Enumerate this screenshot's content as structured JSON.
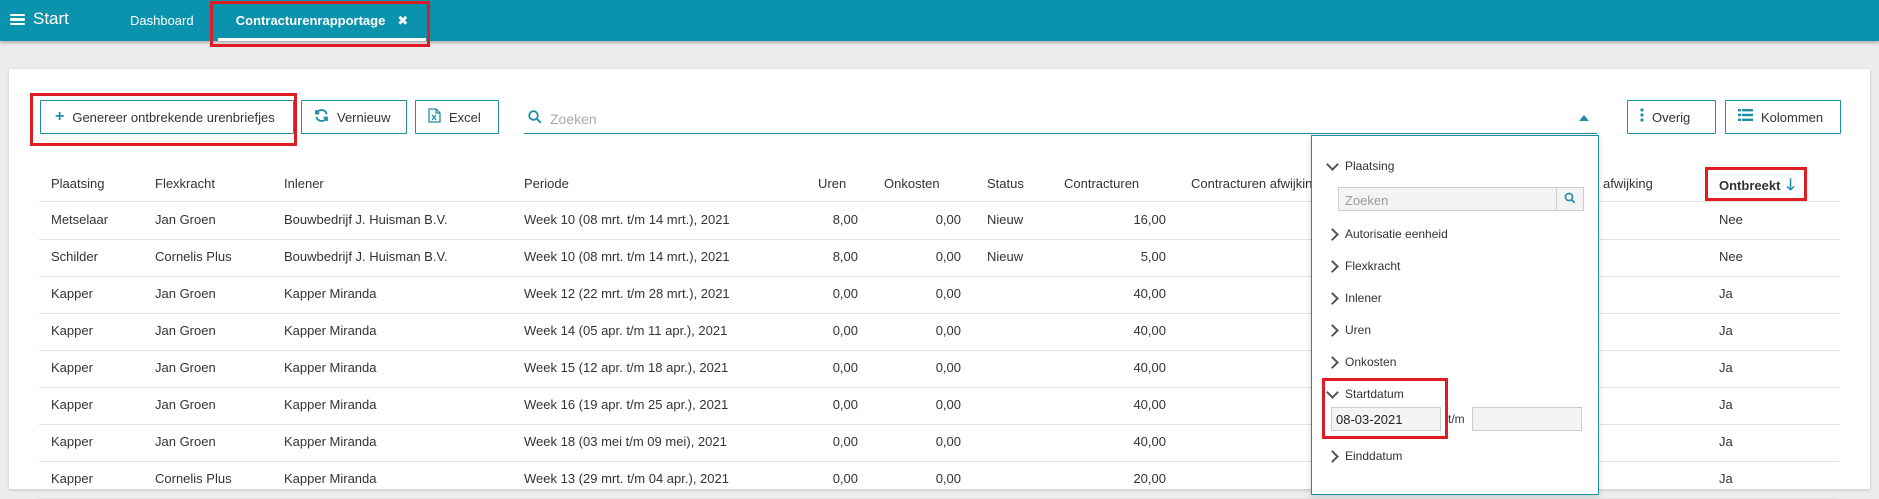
{
  "topbar": {
    "menu_label": "Start",
    "tabs": [
      {
        "label": "Dashboard"
      },
      {
        "label": "Contracturenrapportage",
        "close": "✖"
      }
    ]
  },
  "toolbar": {
    "generate_label": "Genereer ontbrekende urenbriefjes",
    "refresh_label": "Vernieuw",
    "excel_label": "Excel",
    "search_placeholder": "Zoeken",
    "other_label": "Overig",
    "columns_label": "Kolommen"
  },
  "table": {
    "headers": {
      "plaatsing": "Plaatsing",
      "flexkracht": "Flexkracht",
      "inlener": "Inlener",
      "periode": "Periode",
      "uren": "Uren",
      "onkosten": "Onkosten",
      "status": "Status",
      "contracturen": "Contracturen",
      "contracturen_afwijking": "Contracturen afwijkin",
      "afwijking": "afwijking",
      "ontbreekt": "Ontbreekt"
    },
    "rows": [
      {
        "plaatsing": "Metselaar",
        "flexkracht": "Jan Groen",
        "inlener": "Bouwbedrijf J. Huisman B.V.",
        "periode": "Week 10 (08 mrt. t/m 14 mrt.), 2021",
        "uren": "8,00",
        "onkosten": "0,00",
        "status": "Nieuw",
        "contracturen": "16,00",
        "ontbreekt": "Nee"
      },
      {
        "plaatsing": "Schilder",
        "flexkracht": "Cornelis Plus",
        "inlener": "Bouwbedrijf J. Huisman B.V.",
        "periode": "Week 10 (08 mrt. t/m 14 mrt.), 2021",
        "uren": "8,00",
        "onkosten": "0,00",
        "status": "Nieuw",
        "contracturen": "5,00",
        "ontbreekt": "Nee"
      },
      {
        "plaatsing": "Kapper",
        "flexkracht": "Jan Groen",
        "inlener": "Kapper Miranda",
        "periode": "Week 12 (22 mrt. t/m 28 mrt.), 2021",
        "uren": "0,00",
        "onkosten": "0,00",
        "status": "",
        "contracturen": "40,00",
        "ontbreekt": "Ja"
      },
      {
        "plaatsing": "Kapper",
        "flexkracht": "Jan Groen",
        "inlener": "Kapper Miranda",
        "periode": "Week 14 (05 apr. t/m 11 apr.), 2021",
        "uren": "0,00",
        "onkosten": "0,00",
        "status": "",
        "contracturen": "40,00",
        "ontbreekt": "Ja"
      },
      {
        "plaatsing": "Kapper",
        "flexkracht": "Jan Groen",
        "inlener": "Kapper Miranda",
        "periode": "Week 15 (12 apr. t/m 18 apr.), 2021",
        "uren": "0,00",
        "onkosten": "0,00",
        "status": "",
        "contracturen": "40,00",
        "ontbreekt": "Ja"
      },
      {
        "plaatsing": "Kapper",
        "flexkracht": "Jan Groen",
        "inlener": "Kapper Miranda",
        "periode": "Week 16 (19 apr. t/m 25 apr.), 2021",
        "uren": "0,00",
        "onkosten": "0,00",
        "status": "",
        "contracturen": "40,00",
        "ontbreekt": "Ja"
      },
      {
        "plaatsing": "Kapper",
        "flexkracht": "Jan Groen",
        "inlener": "Kapper Miranda",
        "periode": "Week 18 (03 mei t/m 09 mei), 2021",
        "uren": "0,00",
        "onkosten": "0,00",
        "status": "",
        "contracturen": "40,00",
        "ontbreekt": "Ja"
      },
      {
        "plaatsing": "Kapper",
        "flexkracht": "Cornelis Plus",
        "inlener": "Kapper Miranda",
        "periode": "Week 13 (29 mrt. t/m 04 apr.), 2021",
        "uren": "0,00",
        "onkosten": "0,00",
        "status": "",
        "contracturen": "20,00",
        "ontbreekt": "Ja"
      }
    ]
  },
  "filter_panel": {
    "search_placeholder": "Zoeken",
    "items": [
      {
        "label": "Plaatsing",
        "expanded": true
      },
      {
        "label": "Autorisatie eenheid",
        "expanded": false
      },
      {
        "label": "Flexkracht",
        "expanded": false
      },
      {
        "label": "Inlener",
        "expanded": false
      },
      {
        "label": "Uren",
        "expanded": false
      },
      {
        "label": "Onkosten",
        "expanded": false
      },
      {
        "label": "Startdatum",
        "expanded": true
      },
      {
        "label": "Einddatum",
        "expanded": false
      }
    ],
    "startdatum_from": "08-03-2021",
    "startdatum_to": "",
    "range_separator": "t/m"
  },
  "colors": {
    "topbar": "#0b93ad",
    "accent": "#1f8fa6",
    "highlight": "#e01b24"
  }
}
